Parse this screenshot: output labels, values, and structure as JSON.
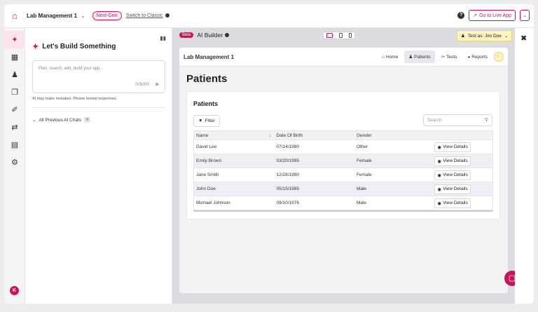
{
  "topbar": {
    "app_name": "Lab Management 1",
    "badge": "Next-Gen",
    "switch_label": "Switch to Classic",
    "go_live_label": "Go to Live App"
  },
  "rail": {
    "items": [
      "ai-builder",
      "tables",
      "users",
      "pages",
      "design",
      "actions",
      "billing",
      "settings"
    ],
    "avatar_initial": "K"
  },
  "chat": {
    "title": "Let's Build Something",
    "placeholder": "Plan, search, edit, build your app...",
    "counter": "0/3000",
    "disclaimer": "AI may make mistakes. Please review responses.",
    "previous_label": "All Previous AI Chats",
    "previous_count": "0"
  },
  "builder": {
    "beta_label": "Beta",
    "title": "AI Builder",
    "test_as": "Test as: Jim Doe"
  },
  "preview": {
    "brand": "Lab Management 1",
    "nav": [
      {
        "label": "Home",
        "icon": "home-icon"
      },
      {
        "label": "Patients",
        "icon": "users-icon",
        "active": true
      },
      {
        "label": "Tests",
        "icon": "syringe-icon"
      },
      {
        "label": "Reports",
        "icon": "chart-icon"
      }
    ],
    "heading": "Patients",
    "card_title": "Patients",
    "filter_label": "Filter",
    "search_placeholder": "Search",
    "columns": [
      "Name",
      "Date Of Birth",
      "Gender"
    ],
    "rows": [
      {
        "name": "David Lee",
        "dob": "07/14/1980",
        "gender": "Other"
      },
      {
        "name": "Emily Brown",
        "dob": "03/20/1995",
        "gender": "Female"
      },
      {
        "name": "Jane Smith",
        "dob": "12/28/1990",
        "gender": "Female"
      },
      {
        "name": "John Doe",
        "dob": "05/15/1985",
        "gender": "Male"
      },
      {
        "name": "Michael Johnson",
        "dob": "09/10/1976",
        "gender": "Male"
      }
    ],
    "view_details_label": "View Details"
  },
  "colors": {
    "accent": "#c2185b",
    "test_as_bg": "#fff3c4"
  }
}
